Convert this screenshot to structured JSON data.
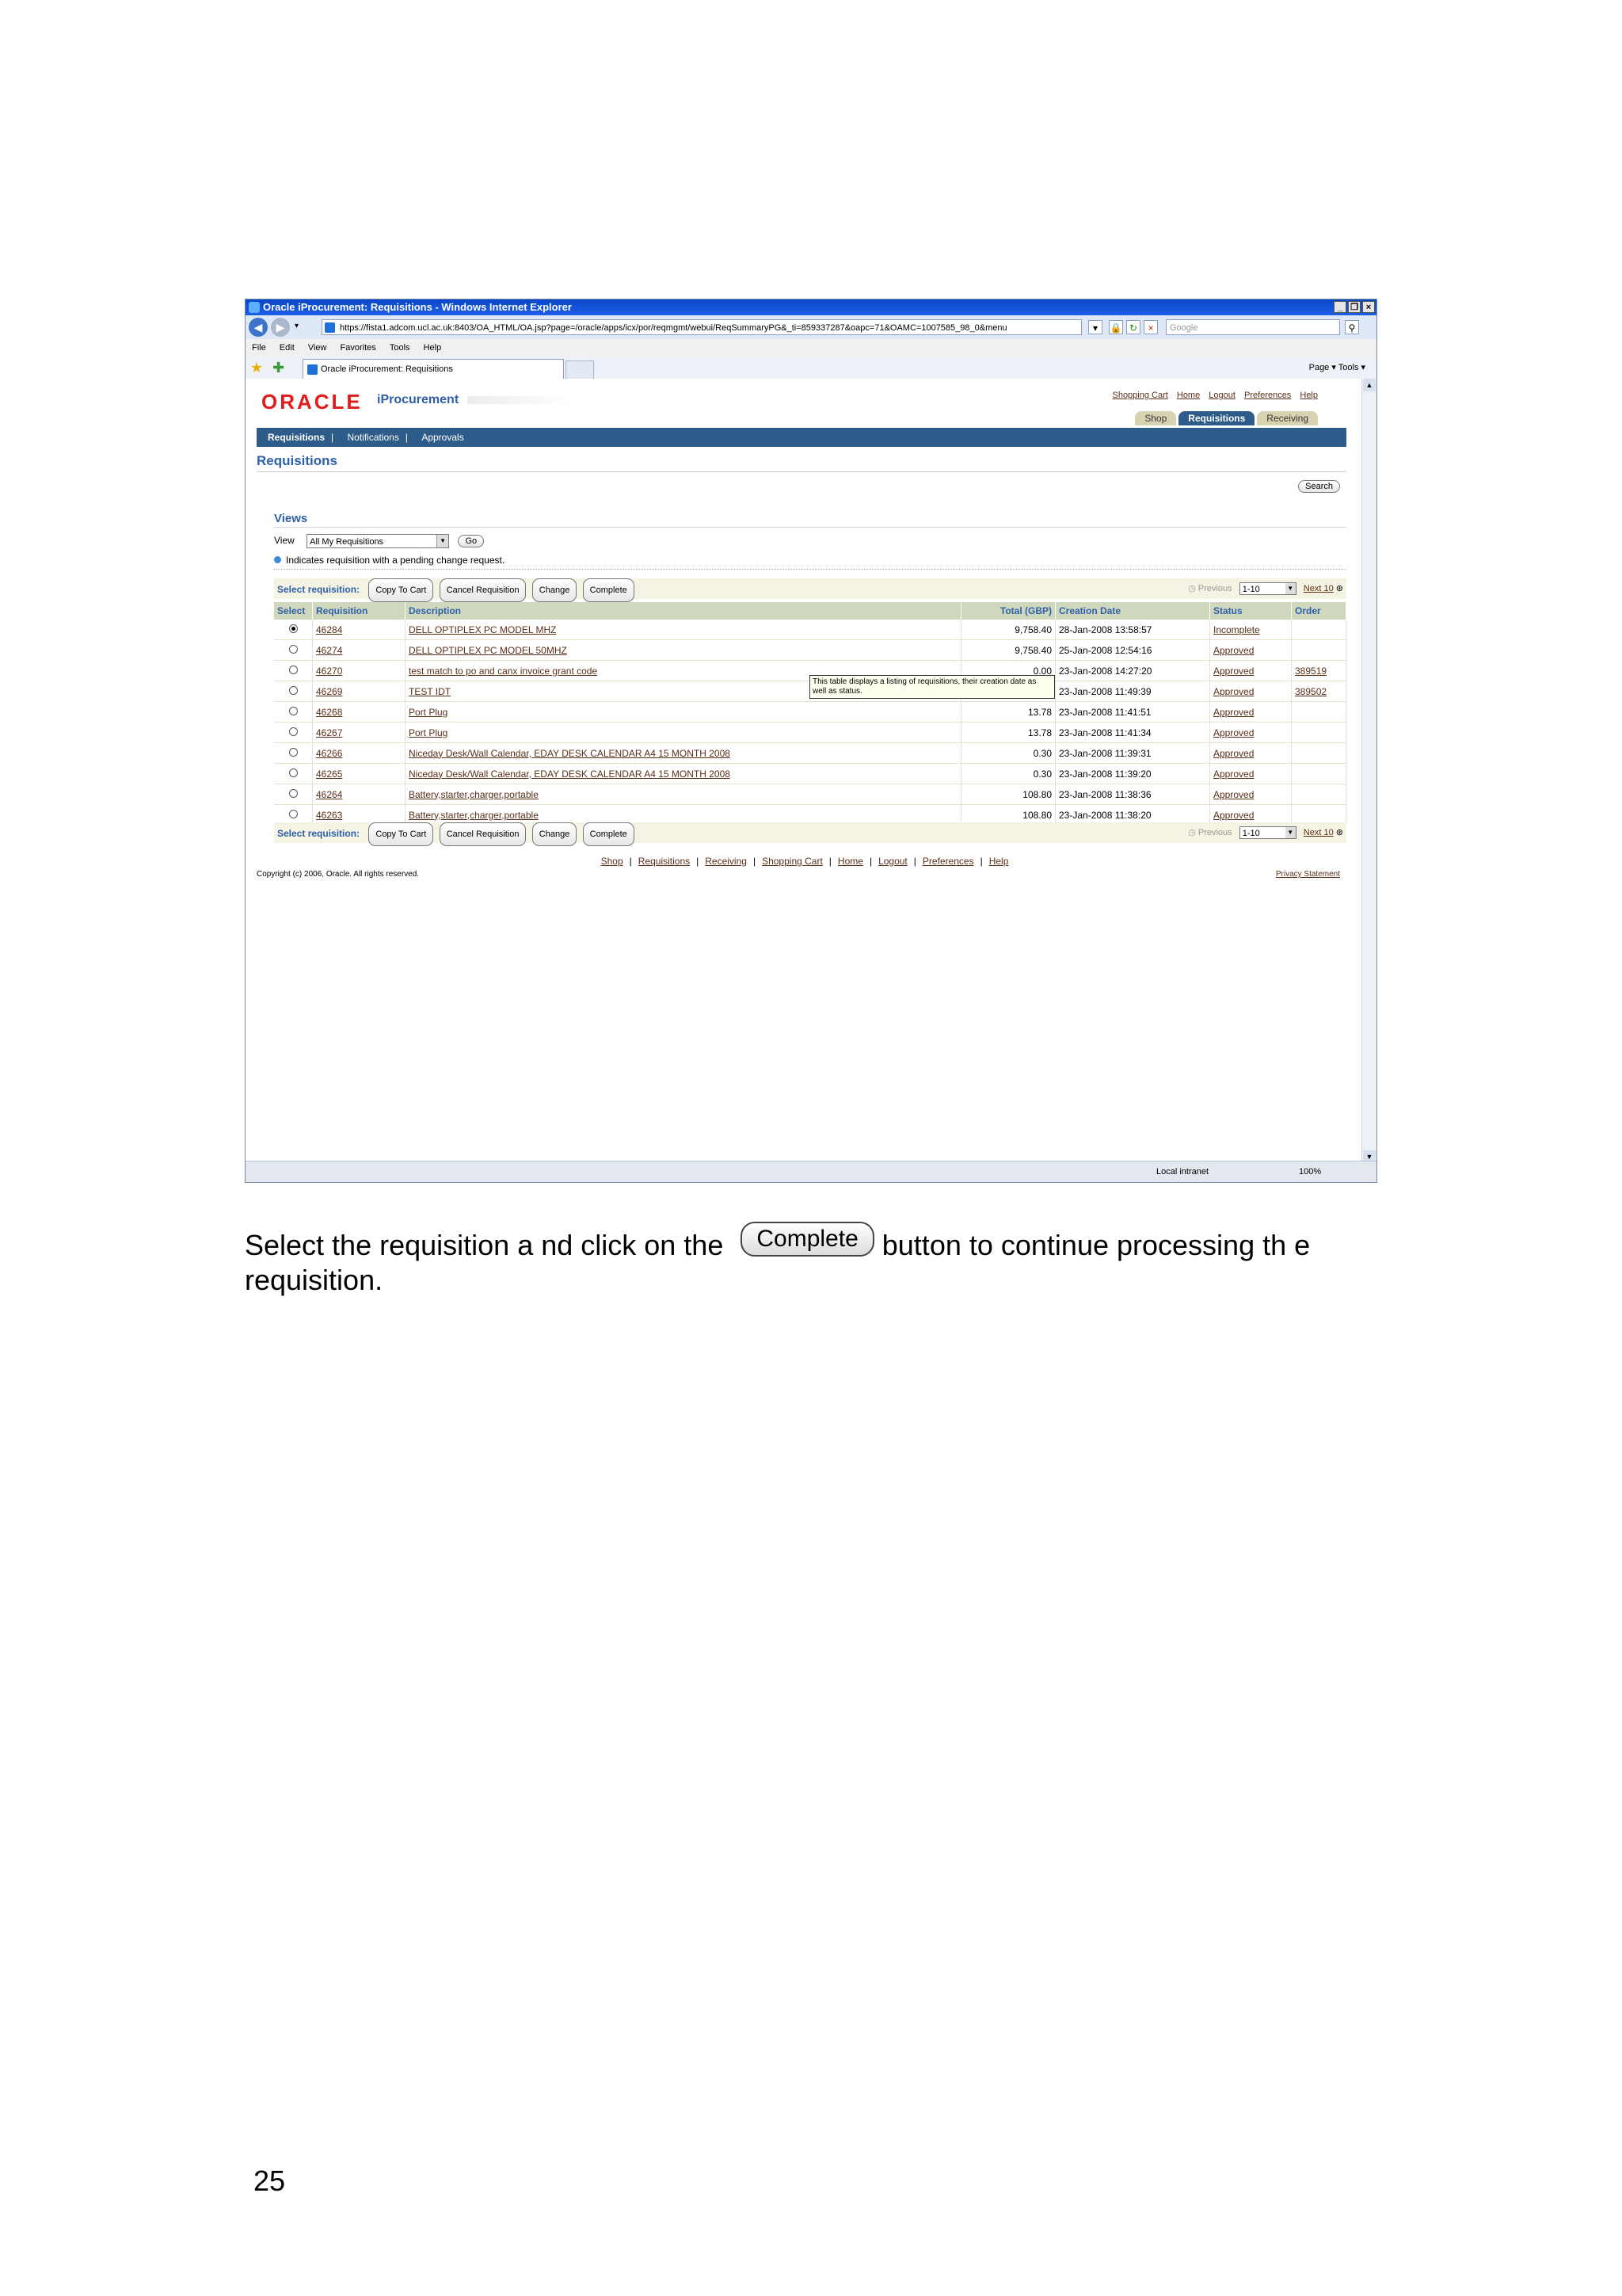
{
  "browser": {
    "window_title": "Oracle iProcurement: Requisitions - Windows Internet Explorer",
    "url": "https://fista1.adcom.ucl.ac.uk:8403/OA_HTML/OA.jsp?page=/oracle/apps/icx/por/reqmgmt/webui/ReqSummaryPG&_ti=859337287&oapc=71&OAMC=1007585_98_0&menu",
    "search_placeholder": "Google",
    "menu": [
      "File",
      "Edit",
      "View",
      "Favorites",
      "Tools",
      "Help"
    ],
    "tab_title": "Oracle iProcurement: Requisitions",
    "command_bar": "Page ▾  Tools ▾",
    "status_zone": "Local intranet",
    "zoom": "100%"
  },
  "app": {
    "logo": "ORACLE",
    "product": "iProcurement",
    "global_links": [
      "Shopping Cart",
      "Home",
      "Logout",
      "Preferences",
      "Help"
    ],
    "tabs": [
      "Shop",
      "Requisitions",
      "Receiving"
    ],
    "active_tab": "Requisitions",
    "subnav": [
      "Requisitions",
      "Notifications",
      "Approvals"
    ],
    "page_title": "Requisitions",
    "search_label": "Search",
    "views_title": "Views",
    "view_label": "View",
    "view_selected": "All My Requisitions",
    "go_label": "Go",
    "pending_note": "Indicates requisition with a pending change request.",
    "select_label": "Select requisition:",
    "buttons": {
      "copy": "Copy To Cart",
      "cancel": "Cancel Requisition",
      "change": "Change",
      "complete": "Complete"
    },
    "pager": {
      "previous": "Previous",
      "range": "1-10",
      "next": "Next 10"
    },
    "columns": [
      "Select",
      "Requisition",
      "Description",
      "Total (GBP)",
      "Creation Date",
      "Status",
      "Order"
    ],
    "rows": [
      {
        "req": "46284",
        "desc": "DELL OPTIPLEX PC MODEL MHZ",
        "total": "9,758.40",
        "date": "28-Jan-2008 13:58:57",
        "status": "Incomplete",
        "order": ""
      },
      {
        "req": "46274",
        "desc": "DELL OPTIPLEX PC MODEL 50MHZ",
        "total": "9,758.40",
        "date": "25-Jan-2008 12:54:16",
        "status": "Approved",
        "order": ""
      },
      {
        "req": "46270",
        "desc": "test match to po and canx invoice grant code",
        "total": "0.00",
        "date": "23-Jan-2008 14:27:20",
        "status": "Approved",
        "order": "389519"
      },
      {
        "req": "46269",
        "desc": "TEST IDT",
        "total": "",
        "date": "23-Jan-2008 11:49:39",
        "status": "Approved",
        "order": "389502"
      },
      {
        "req": "46268",
        "desc": "Port Plug",
        "total": "13.78",
        "date": "23-Jan-2008 11:41:51",
        "status": "Approved",
        "order": ""
      },
      {
        "req": "46267",
        "desc": "Port Plug",
        "total": "13.78",
        "date": "23-Jan-2008 11:41:34",
        "status": "Approved",
        "order": ""
      },
      {
        "req": "46266",
        "desc": "Niceday Desk/Wall Calendar, EDAY DESK CALENDAR A4 15 MONTH 2008",
        "total": "0.30",
        "date": "23-Jan-2008 11:39:31",
        "status": "Approved",
        "order": ""
      },
      {
        "req": "46265",
        "desc": "Niceday Desk/Wall Calendar, EDAY DESK CALENDAR A4 15 MONTH 2008",
        "total": "0.30",
        "date": "23-Jan-2008 11:39:20",
        "status": "Approved",
        "order": ""
      },
      {
        "req": "46264",
        "desc": "Battery,starter,charger,portable",
        "total": "108.80",
        "date": "23-Jan-2008 11:38:36",
        "status": "Approved",
        "order": ""
      },
      {
        "req": "46263",
        "desc": "Battery,starter,charger,portable",
        "total": "108.80",
        "date": "23-Jan-2008 11:38:20",
        "status": "Approved",
        "order": ""
      }
    ],
    "tooltip": "This table displays a listing of  requisitions, their creation date as well as status.",
    "footer_links": [
      "Shop",
      "Requisitions",
      "Receiving",
      "Shopping Cart",
      "Home",
      "Logout",
      "Preferences",
      "Help"
    ],
    "copyright": "Copyright (c) 2006, Oracle. All rights reserved.",
    "privacy": "Privacy Statement"
  },
  "document": {
    "caption_before": "Select the requisition a nd click on the",
    "caption_button": "Complete",
    "caption_after": "button to continue processing th e requisition.",
    "page_number": "25"
  }
}
